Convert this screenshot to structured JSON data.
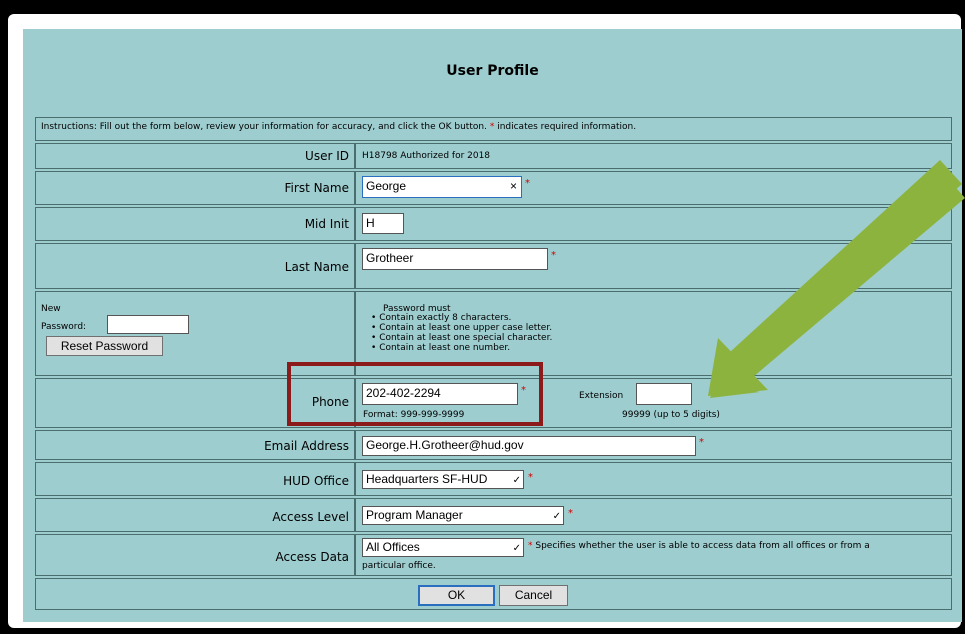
{
  "title": "User Profile",
  "instructions": {
    "text": "Instructions: Fill out the form below, review your information for accuracy, and click the OK button.",
    "req_mark": "*",
    "suffix": "indicates required information."
  },
  "user_id": {
    "label": "User ID",
    "value": "H18798 Authorized for  2018"
  },
  "first_name": {
    "label": "First Name",
    "value": "George",
    "clear": "×"
  },
  "mid_init": {
    "label": "Mid Init",
    "value": "H"
  },
  "last_name": {
    "label": "Last Name",
    "value": "Grotheer"
  },
  "password": {
    "new_label": "New",
    "password_label": "Password:",
    "reset_button": "Reset Password",
    "rules_title": "Password must",
    "rules": [
      "Contain exactly 8 characters.",
      "Contain at least one upper case letter.",
      "Contain at least one special character.",
      "Contain at least one number."
    ]
  },
  "phone": {
    "label": "Phone",
    "value": "202-402-2294",
    "format": "Format: 999-999-9999"
  },
  "extension": {
    "label": "Extension",
    "value": "",
    "format": "99999 (up to 5 digits)"
  },
  "email": {
    "label": "Email Address",
    "value": "George.H.Grotheer@hud.gov"
  },
  "hud_office": {
    "label": "HUD Office",
    "value": "Headquarters SF-HUD"
  },
  "access_level": {
    "label": "Access Level",
    "value": "Program Manager"
  },
  "access_data": {
    "label": "Access Data",
    "value": "All Offices",
    "note_line1": "Specifies whether the user is able to access data from all offices or from a",
    "note_line2": "particular office."
  },
  "buttons": {
    "ok": "OK",
    "cancel": "Cancel"
  },
  "colors": {
    "panel": "#9ecdcf",
    "required": "#d00000",
    "highlight": "#8b1a1a",
    "arrow": "#8db33f"
  },
  "req_mark": "*",
  "bullet": "•"
}
